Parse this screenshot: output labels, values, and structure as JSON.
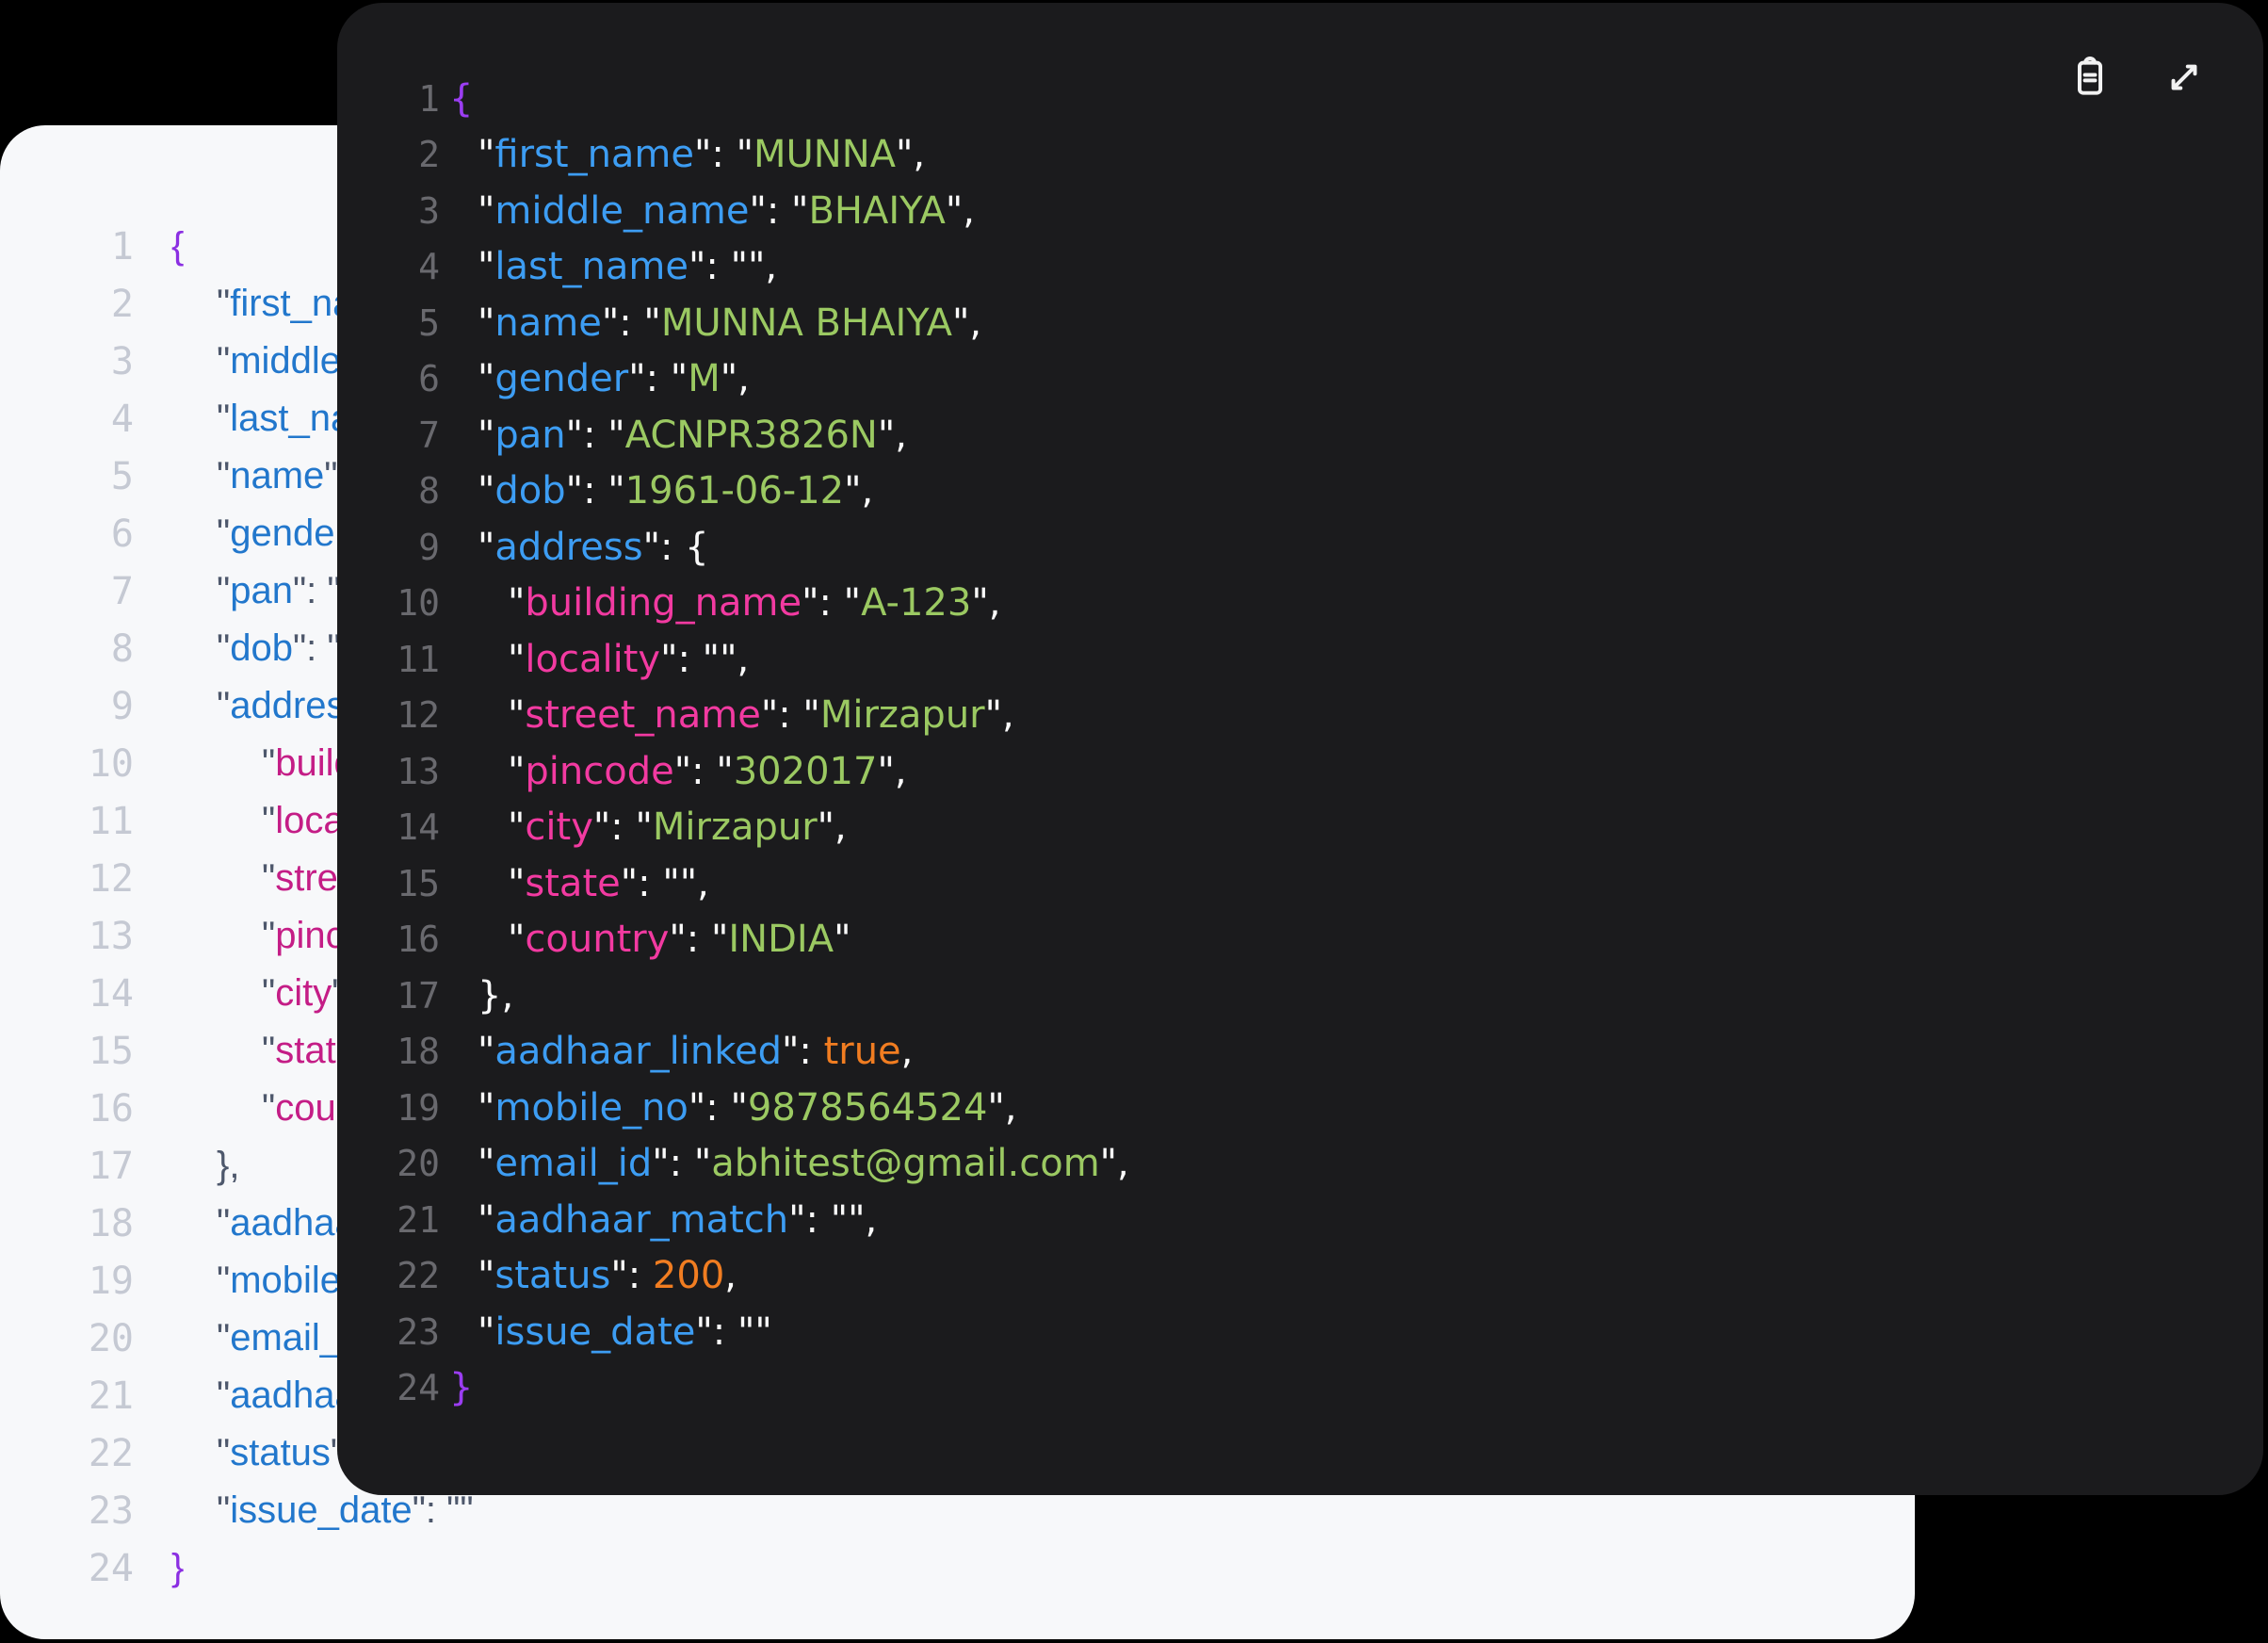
{
  "window": {
    "background_color": "#000000"
  },
  "toolbar": {
    "icons": [
      {
        "name": "clipboard-icon",
        "action_label": "Copy JSON"
      },
      {
        "name": "expand-icon",
        "action_label": "Expand view"
      }
    ]
  },
  "themes": {
    "dark_panel": {
      "background": "#1b1b1d",
      "line_number": "#69696e",
      "key_top_level": "#3d9df3",
      "key_nested": "#f23aa1",
      "string_value": "#9bc962",
      "number_bool_value": "#f17d21",
      "punctuation": "#fafafa",
      "outer_brace": "#9b3df2"
    },
    "light_panel": {
      "background": "#f7f8fa",
      "line_number": "#c5c9d3",
      "key_top_level": "#2277cc",
      "key_nested": "#c41d86",
      "punctuation": "#4e586c",
      "outer_brace": "#8b2fe2"
    }
  },
  "document": {
    "first_name": "MUNNA",
    "middle_name": "BHAIYA",
    "last_name": "",
    "name": "MUNNA BHAIYA",
    "gender": "M",
    "pan": "ACNPR3826N",
    "dob": "1961-06-12",
    "address": {
      "building_name": "A-123",
      "locality": "",
      "street_name": "Mirzapur",
      "pincode": "302017",
      "city": "Mirzapur",
      "state": "",
      "country": "INDIA"
    },
    "aadhaar_linked": true,
    "mobile_no": "9878564524",
    "email_id": "abhitest@gmail.com",
    "aadhaar_match": "",
    "status": 200,
    "issue_date": ""
  },
  "code_lines": [
    {
      "n": 1,
      "ind": 0,
      "tok": [
        [
          "b1",
          "{"
        ]
      ]
    },
    {
      "n": 2,
      "ind": 1,
      "tok": [
        [
          "p",
          "\""
        ],
        [
          "k1",
          "first_name"
        ],
        [
          "p",
          "\": \""
        ],
        [
          "s",
          "MUNNA"
        ],
        [
          "p",
          "\","
        ]
      ]
    },
    {
      "n": 3,
      "ind": 1,
      "tok": [
        [
          "p",
          "\""
        ],
        [
          "k1",
          "middle_name"
        ],
        [
          "p",
          "\": \""
        ],
        [
          "s",
          "BHAIYA"
        ],
        [
          "p",
          "\","
        ]
      ]
    },
    {
      "n": 4,
      "ind": 1,
      "tok": [
        [
          "p",
          "\""
        ],
        [
          "k1",
          "last_name"
        ],
        [
          "p",
          "\": \"\","
        ]
      ]
    },
    {
      "n": 5,
      "ind": 1,
      "tok": [
        [
          "p",
          "\""
        ],
        [
          "k1",
          "name"
        ],
        [
          "p",
          "\": \""
        ],
        [
          "s",
          "MUNNA BHAIYA"
        ],
        [
          "p",
          "\","
        ]
      ]
    },
    {
      "n": 6,
      "ind": 1,
      "tok": [
        [
          "p",
          "\""
        ],
        [
          "k1",
          "gender"
        ],
        [
          "p",
          "\": \""
        ],
        [
          "s",
          "M"
        ],
        [
          "p",
          "\","
        ]
      ]
    },
    {
      "n": 7,
      "ind": 1,
      "tok": [
        [
          "p",
          "\""
        ],
        [
          "k1",
          "pan"
        ],
        [
          "p",
          "\": \""
        ],
        [
          "s",
          "ACNPR3826N"
        ],
        [
          "p",
          "\","
        ]
      ]
    },
    {
      "n": 8,
      "ind": 1,
      "tok": [
        [
          "p",
          "\""
        ],
        [
          "k1",
          "dob"
        ],
        [
          "p",
          "\": \""
        ],
        [
          "s",
          "1961-06-12"
        ],
        [
          "p",
          "\","
        ]
      ]
    },
    {
      "n": 9,
      "ind": 1,
      "tok": [
        [
          "p",
          "\""
        ],
        [
          "k1",
          "address"
        ],
        [
          "p",
          "\": {"
        ]
      ]
    },
    {
      "n": 10,
      "ind": 2,
      "tok": [
        [
          "p",
          "\""
        ],
        [
          "k2",
          "building_name"
        ],
        [
          "p",
          "\": \""
        ],
        [
          "s",
          "A-123"
        ],
        [
          "p",
          "\","
        ]
      ]
    },
    {
      "n": 11,
      "ind": 2,
      "tok": [
        [
          "p",
          "\""
        ],
        [
          "k2",
          "locality"
        ],
        [
          "p",
          "\": \"\","
        ]
      ]
    },
    {
      "n": 12,
      "ind": 2,
      "tok": [
        [
          "p",
          "\""
        ],
        [
          "k2",
          "street_name"
        ],
        [
          "p",
          "\": \""
        ],
        [
          "s",
          "Mirzapur"
        ],
        [
          "p",
          "\","
        ]
      ]
    },
    {
      "n": 13,
      "ind": 2,
      "tok": [
        [
          "p",
          "\""
        ],
        [
          "k2",
          "pincode"
        ],
        [
          "p",
          "\": \""
        ],
        [
          "s",
          "302017"
        ],
        [
          "p",
          "\","
        ]
      ]
    },
    {
      "n": 14,
      "ind": 2,
      "tok": [
        [
          "p",
          "\""
        ],
        [
          "k2",
          "city"
        ],
        [
          "p",
          "\": \""
        ],
        [
          "s",
          "Mirzapur"
        ],
        [
          "p",
          "\","
        ]
      ]
    },
    {
      "n": 15,
      "ind": 2,
      "tok": [
        [
          "p",
          "\""
        ],
        [
          "k2",
          "state"
        ],
        [
          "p",
          "\": \"\","
        ]
      ]
    },
    {
      "n": 16,
      "ind": 2,
      "tok": [
        [
          "p",
          "\""
        ],
        [
          "k2",
          "country"
        ],
        [
          "p",
          "\": \""
        ],
        [
          "s",
          "INDIA"
        ],
        [
          "p",
          "\""
        ]
      ]
    },
    {
      "n": 17,
      "ind": 1,
      "tok": [
        [
          "p",
          "},"
        ]
      ]
    },
    {
      "n": 18,
      "ind": 1,
      "tok": [
        [
          "p",
          "\""
        ],
        [
          "k1",
          "aadhaar_linked"
        ],
        [
          "p",
          "\": "
        ],
        [
          "n",
          "true"
        ],
        [
          "p",
          ","
        ]
      ]
    },
    {
      "n": 19,
      "ind": 1,
      "tok": [
        [
          "p",
          "\""
        ],
        [
          "k1",
          "mobile_no"
        ],
        [
          "p",
          "\": \""
        ],
        [
          "s",
          "9878564524"
        ],
        [
          "p",
          "\","
        ]
      ]
    },
    {
      "n": 20,
      "ind": 1,
      "tok": [
        [
          "p",
          "\""
        ],
        [
          "k1",
          "email_id"
        ],
        [
          "p",
          "\": \""
        ],
        [
          "s",
          "abhitest@gmail.com"
        ],
        [
          "p",
          "\","
        ]
      ]
    },
    {
      "n": 21,
      "ind": 1,
      "tok": [
        [
          "p",
          "\""
        ],
        [
          "k1",
          "aadhaar_match"
        ],
        [
          "p",
          "\": \"\","
        ]
      ]
    },
    {
      "n": 22,
      "ind": 1,
      "tok": [
        [
          "p",
          "\""
        ],
        [
          "k1",
          "status"
        ],
        [
          "p",
          "\": "
        ],
        [
          "n",
          "200"
        ],
        [
          "p",
          ","
        ]
      ]
    },
    {
      "n": 23,
      "ind": 1,
      "tok": [
        [
          "p",
          "\""
        ],
        [
          "k1",
          "issue_date"
        ],
        [
          "p",
          "\": \"\""
        ]
      ]
    },
    {
      "n": 24,
      "ind": 0,
      "tok": [
        [
          "b1",
          "}"
        ]
      ]
    }
  ]
}
